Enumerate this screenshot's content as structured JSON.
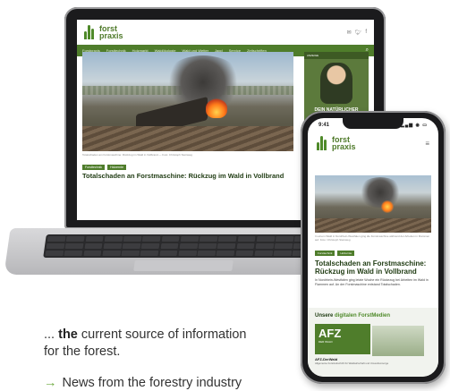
{
  "desktop_site": {
    "logo_line1": "forst",
    "logo_line2": "praxis",
    "social_icons": [
      "email-icon",
      "twitter-icon",
      "facebook-icon"
    ],
    "nav_items": [
      "Forstpraxis",
      "Forsttechnik",
      "Holzmarkt",
      "Waldökologie",
      "Wald und Wetter",
      "Jagd",
      "Service",
      "Zeitschriften"
    ],
    "nav_search_icon": "search-icon",
    "caption": "Totalschaden am Forstmaschine: Rückzug im Wald in Vollbrand — Foto: Christoph Steinweg",
    "tags": [
      "Forsttechnik",
      "Holzernte"
    ],
    "headline": "Totalschaden an Forstmaschine: Rückzug im Wald in Vollbrand",
    "sidebar_label": "ANZEIGE",
    "sidebar_text": "DEIN NATÜRLICHER SCHUTZ FÜR"
  },
  "mobile_site": {
    "status_time": "9:41",
    "status_icons": "▂▄▆ ◉ ▭",
    "logo_line1": "forst",
    "logo_line2": "praxis",
    "menu_icon": "≡",
    "caption": "In einem Wald in Nordrhein-Westfalen ging die Forstmaschine während der Arbeiten in Flammen auf. Foto: Christoph Steinweg",
    "tags": [
      "Forsttechnik",
      "Holzernte"
    ],
    "headline": "Totalschaden an Forstmaschine: Rückzug im Wald in Vollbrand",
    "teaser": "In Nordrhein-Westfalen ging letzte Woche ein Rückezug bei Arbeiten im Wald in Flammen auf. An der Forstmaschine entstand Totalschaden.",
    "promo_title_prefix": "Unsere",
    "promo_title_highlight": "digitalen ForstMedien",
    "promo_logo": "AFZ",
    "promo_logo_sub": "DER WALD",
    "promo_item_title": "AFZ-DerWald",
    "promo_item_sub": "Allgemeine Forstzeitschrift für Waldwirtschaft und Umweltvorsorge"
  },
  "marketing": {
    "lead_prefix": "... ",
    "lead_bold": "the",
    "lead_rest": " current source of information for the forest.",
    "bullet_arrow": "→",
    "bullet_text": "News from the forestry industry"
  },
  "colors": {
    "brand_green": "#4f7d2b",
    "accent_green": "#6aa83a",
    "device_dark": "#1a1a1c"
  }
}
